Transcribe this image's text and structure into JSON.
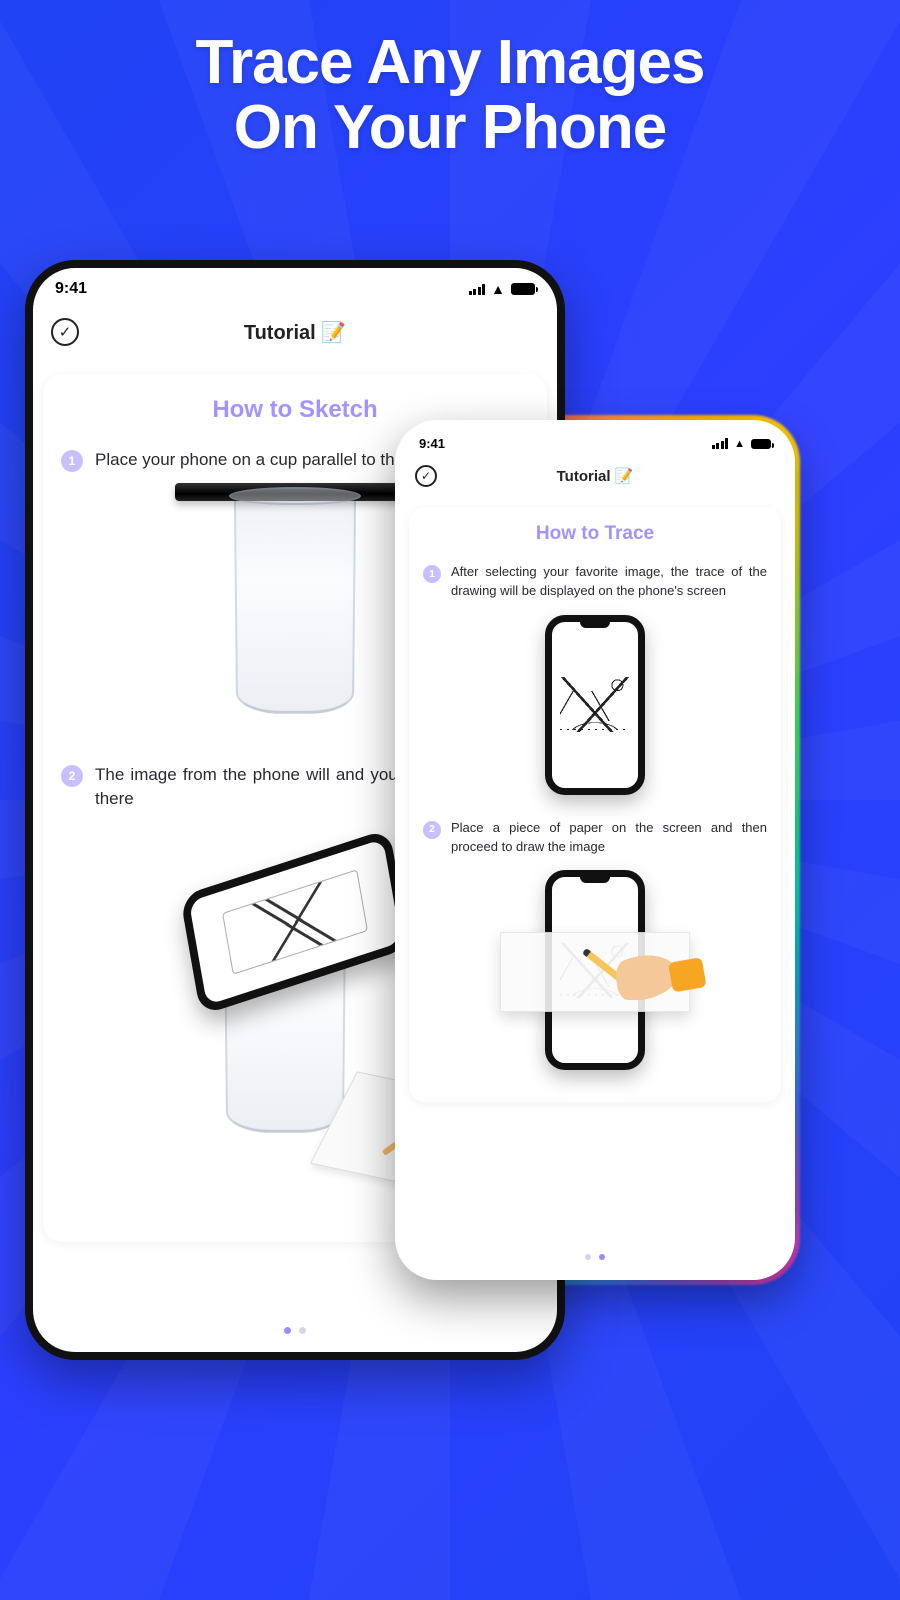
{
  "hero": {
    "line1": "Trace Any Images",
    "line2": "On Your Phone"
  },
  "backPhone": {
    "status_time": "9:41",
    "header_title": "Tutorial 📝",
    "card_title": "How to Sketch",
    "step1_num": "1",
    "step1_text": "Place your phone on a cup parallel to the table",
    "step2_num": "2",
    "step2_text": "The image from the phone will and you can draw it from there"
  },
  "frontPhone": {
    "status_time": "9:41",
    "header_title": "Tutorial 📝",
    "card_title": "How to Trace",
    "step1_num": "1",
    "step1_text": "After selecting your favorite image, the trace of the drawing will be displayed on the phone's screen",
    "step2_num": "2",
    "step2_text": "Place a piece of paper on the screen and then proceed to draw the image"
  }
}
